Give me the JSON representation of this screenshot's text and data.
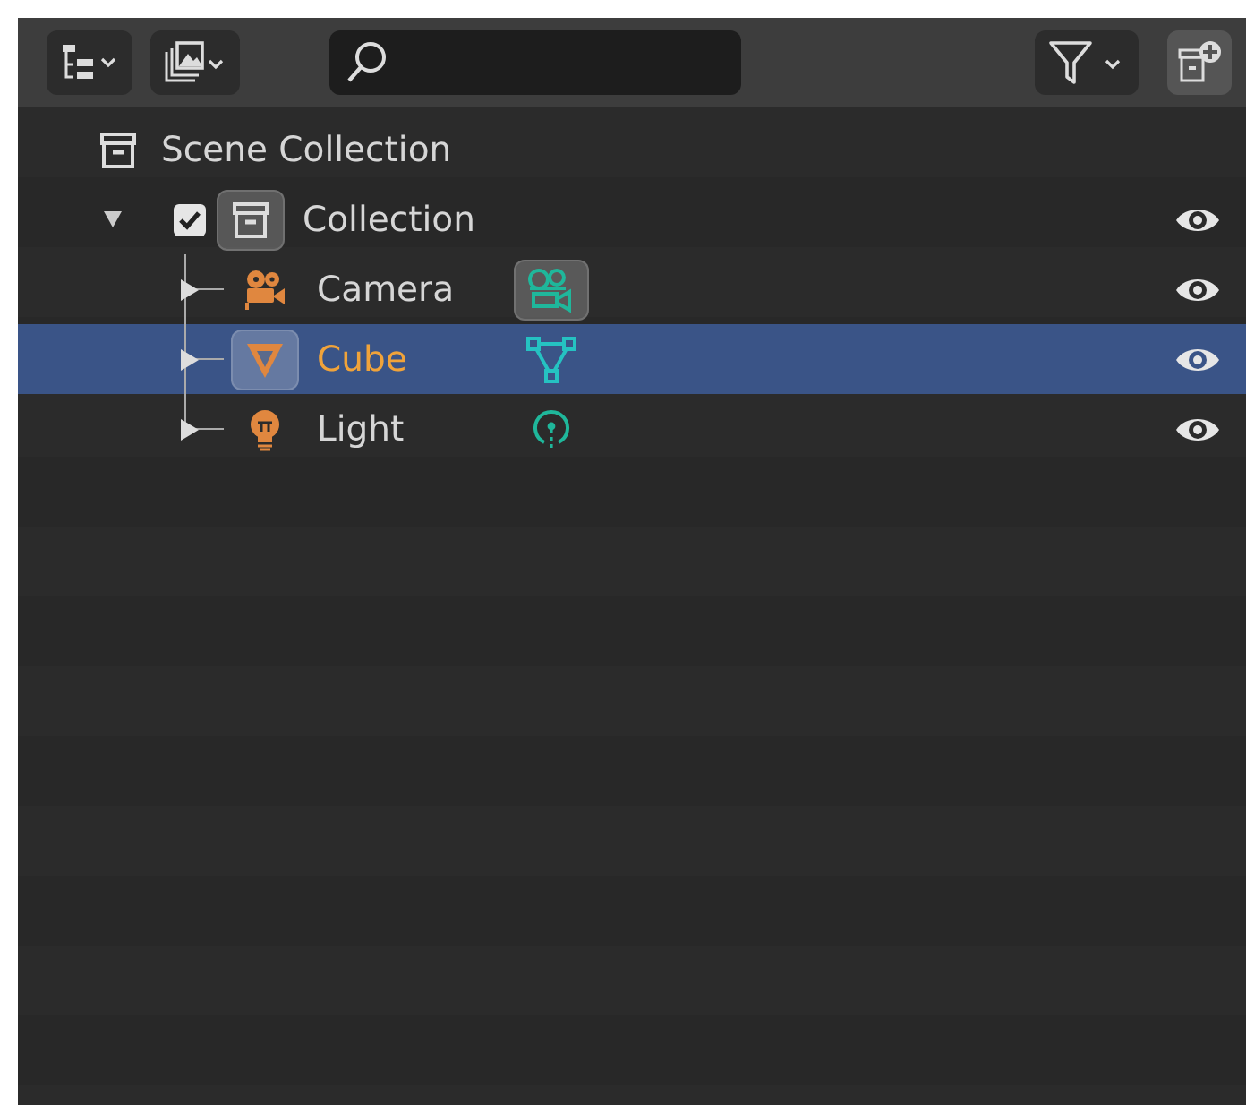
{
  "scene_collection": {
    "name": "Scene Collection",
    "children": [
      {
        "name": "Collection",
        "expanded": true,
        "checked": true,
        "icon_active": true,
        "visible": true,
        "children": [
          {
            "name": "Camera",
            "kind": "camera",
            "expanded": false,
            "selected": false,
            "object_icon_active": false,
            "data_icon_active": true,
            "visible": true
          },
          {
            "name": "Cube",
            "kind": "mesh",
            "expanded": false,
            "selected": true,
            "object_icon_active": true,
            "data_icon_active": false,
            "visible": true
          },
          {
            "name": "Light",
            "kind": "light",
            "expanded": false,
            "selected": false,
            "object_icon_active": false,
            "data_icon_active": false,
            "visible": true
          }
        ]
      }
    ]
  }
}
